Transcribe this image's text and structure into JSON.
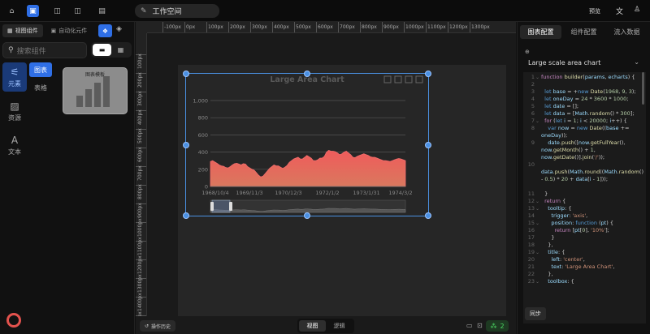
{
  "topbar": {
    "workspace_title": "工作空间",
    "preview_label": "预览",
    "right_icons": [
      "translate-icon",
      "user-icon"
    ]
  },
  "left": {
    "tabs": [
      {
        "label": "视图组件",
        "active": true
      },
      {
        "label": "自动化元件",
        "active": false
      }
    ],
    "search_placeholder": "搜索组件",
    "rail": [
      {
        "label": "元素",
        "icon": "elements-icon",
        "active": true
      },
      {
        "label": "资源",
        "icon": "image-icon",
        "active": false
      },
      {
        "label": "文本",
        "icon": "text-icon",
        "active": false
      }
    ],
    "categories": [
      {
        "label": "图表",
        "active": true
      },
      {
        "label": "表格",
        "active": false
      }
    ],
    "template_card_label": "图表模板"
  },
  "rulers": {
    "h": [
      "-100px",
      "0px",
      "100px",
      "200px",
      "300px",
      "400px",
      "500px",
      "600px",
      "700px",
      "800px",
      "900px",
      "1000px",
      "1100px",
      "1200px",
      "1300px"
    ],
    "v": [
      "100px",
      "200px",
      "300px",
      "400px",
      "500px",
      "600px",
      "700px",
      "800px",
      "900px",
      "1000px",
      "1100px",
      "1200px",
      "1300px",
      "1400px",
      "1500px",
      "1600px"
    ]
  },
  "chart_data": {
    "type": "area",
    "title": "Large Area Chart",
    "x_tick_labels": [
      "1968/10/4",
      "1969/11/3",
      "1970/12/3",
      "1972/1/2",
      "1973/1/31",
      "1974/3/2"
    ],
    "y_ticks": [
      0,
      200,
      400,
      600,
      800,
      "1,000"
    ],
    "ylim": [
      0,
      1000
    ],
    "values": [
      290,
      300,
      285,
      270,
      250,
      240,
      235,
      220,
      215,
      230,
      250,
      265,
      270,
      260,
      250,
      265,
      260,
      230,
      215,
      200,
      190,
      160,
      130,
      110,
      120,
      150,
      180,
      210,
      230,
      250,
      240,
      240,
      225,
      210,
      225,
      245,
      280,
      300,
      320,
      330,
      340,
      320,
      320,
      340,
      360,
      345,
      330,
      300,
      300,
      310,
      330,
      330,
      350,
      400,
      420,
      410,
      410,
      405,
      390,
      370,
      380,
      400,
      410,
      390,
      370,
      340,
      335,
      350,
      360,
      370,
      380,
      370,
      360,
      345,
      340,
      340,
      330,
      320,
      310,
      300,
      300,
      295,
      290,
      300,
      310,
      320,
      325,
      320,
      310,
      300
    ],
    "area_color_top": "#f05b5b",
    "area_color_bottom": "#d9785e",
    "grid": true,
    "datazoom": true
  },
  "bottom": {
    "history_label": "操作历史",
    "modes": [
      {
        "label": "视图",
        "active": true
      },
      {
        "label": "逻辑",
        "active": false
      }
    ],
    "online_count": "2"
  },
  "right": {
    "tabs": [
      {
        "label": "图表配置",
        "active": true
      },
      {
        "label": "组件配置",
        "active": false
      },
      {
        "label": "流入数据",
        "active": false
      }
    ],
    "select_value": "Large scale area chart",
    "sync_label": "同步",
    "code": [
      {
        "n": "1",
        "fold": "⌄",
        "lines": 1,
        "html": "<span class='kw'>function</span> <span class='fn'>builder</span><span class='pl'>(</span><span class='id'>params</span><span class='pl'>, </span><span class='id'>echarts</span><span class='pl'>) {</span>"
      },
      {
        "n": "2",
        "fold": "",
        "lines": 1,
        "html": ""
      },
      {
        "n": "3",
        "fold": "",
        "lines": 1,
        "html": "&nbsp;&nbsp;<span class='kw2'>let</span> <span class='id'>base</span> <span class='pl'>= +</span><span class='kw2'>new</span> <span class='fn'>Date</span><span class='pl'>(</span><span class='num'>1968</span><span class='pl'>, </span><span class='num'>9</span><span class='pl'>, </span><span class='num'>3</span><span class='pl'>);</span>"
      },
      {
        "n": "4",
        "fold": "",
        "lines": 1,
        "html": "&nbsp;&nbsp;<span class='kw2'>let</span> <span class='id'>oneDay</span> <span class='pl'>= </span><span class='num'>24</span> <span class='pl'>*</span> <span class='num'>3600</span> <span class='pl'>*</span> <span class='num'>1000</span><span class='pl'>;</span>"
      },
      {
        "n": "5",
        "fold": "",
        "lines": 1,
        "html": "&nbsp;&nbsp;<span class='kw2'>let</span> <span class='id'>date</span> <span class='pl'>= [];</span>"
      },
      {
        "n": "6",
        "fold": "",
        "lines": 1,
        "html": "&nbsp;&nbsp;<span class='kw2'>let</span> <span class='id'>data</span> <span class='pl'>= [</span><span class='id'>Math</span><span class='pl'>.</span><span class='fn'>random</span><span class='pl'>() * </span><span class='num'>300</span><span class='pl'>];</span>"
      },
      {
        "n": "7",
        "fold": "⌄",
        "lines": 1,
        "html": "&nbsp;&nbsp;<span class='kw'>for</span> <span class='pl'>(</span><span class='kw2'>let</span> <span class='id'>i</span> <span class='pl'>= </span><span class='num'>1</span><span class='pl'>; </span><span class='id'>i</span> <span class='pl'>&lt; </span><span class='num'>20000</span><span class='pl'>; </span><span class='id'>i</span><span class='pl'>++) {</span>"
      },
      {
        "n": "8",
        "fold": "",
        "lines": 2,
        "html": "&nbsp;&nbsp;&nbsp;&nbsp;<span class='kw2'>var</span> <span class='id'>now</span> <span class='pl'>= </span><span class='kw2'>new</span> <span class='fn'>Date</span><span class='pl'>((</span><span class='id'>base</span> <span class='pl'>+= </span><span class='id'>oneDay</span><span class='pl'>));</span>"
      },
      {
        "n": "9",
        "fold": "",
        "lines": 3,
        "html": "&nbsp;&nbsp;&nbsp;&nbsp;<span class='id'>date</span><span class='pl'>.</span><span class='fn'>push</span><span class='pl'>([</span><span class='id'>now</span><span class='pl'>.</span><span class='fn'>getFullYear</span><span class='pl'>(), </span><span class='id'>now</span><span class='pl'>.</span><span class='fn'>getMonth</span><span class='pl'>() + </span><span class='num'>1</span><span class='pl'>, </span><span class='id'>now</span><span class='pl'>.</span><span class='fn'>getDate</span><span class='pl'>()].</span><span class='fn'>join</span><span class='pl'>(</span><span class='str'>'/'</span><span class='pl'>));</span>"
      },
      {
        "n": "10",
        "fold": "",
        "lines": 4,
        "html": "<br><span class='id'>data</span><span class='pl'>.</span><span class='fn'>push</span><span class='pl'>(</span><span class='id'>Math</span><span class='pl'>.</span><span class='fn'>round</span><span class='pl'>((</span><span class='id'>Math</span><span class='pl'>.</span><span class='fn'>random</span><span class='pl'>() - </span><span class='num'>0.5</span><span class='pl'>) * </span><span class='num'>20</span> <span class='pl'>+ </span><span class='id'>data</span><span class='pl'>[</span><span class='id'>i</span> <span class='pl'>- </span><span class='num'>1</span><span class='pl'>]));</span>"
      },
      {
        "n": "11",
        "fold": "",
        "lines": 1,
        "html": "&nbsp;&nbsp;<span class='pl'>}</span>"
      },
      {
        "n": "12",
        "fold": "⌄",
        "lines": 1,
        "html": "&nbsp;&nbsp;<span class='kw'>return</span> <span class='pl'>{</span>"
      },
      {
        "n": "13",
        "fold": "⌄",
        "lines": 1,
        "html": "&nbsp;&nbsp;&nbsp;&nbsp;<span class='id'>tooltip</span><span class='pl'>: {</span>"
      },
      {
        "n": "14",
        "fold": "",
        "lines": 1,
        "html": "&nbsp;&nbsp;&nbsp;&nbsp;&nbsp;&nbsp;<span class='id'>trigger</span><span class='pl'>: </span><span class='str'>'axis'</span><span class='pl'>,</span>"
      },
      {
        "n": "15",
        "fold": "⌄",
        "lines": 1,
        "html": "&nbsp;&nbsp;&nbsp;&nbsp;&nbsp;&nbsp;<span class='id'>position</span><span class='pl'>: </span><span class='kw2'>function</span> <span class='pl'>(</span><span class='id'>pt</span><span class='pl'>) {</span>"
      },
      {
        "n": "16",
        "fold": "",
        "lines": 1,
        "html": "&nbsp;&nbsp;&nbsp;&nbsp;&nbsp;&nbsp;&nbsp;&nbsp;<span class='kw'>return</span> <span class='pl'>[</span><span class='id'>pt</span><span class='pl'>[</span><span class='num'>0</span><span class='pl'>], </span><span class='str'>'10%'</span><span class='pl'>];</span>"
      },
      {
        "n": "17",
        "fold": "",
        "lines": 1,
        "html": "&nbsp;&nbsp;&nbsp;&nbsp;&nbsp;&nbsp;<span class='pl'>}</span>"
      },
      {
        "n": "18",
        "fold": "",
        "lines": 1,
        "html": "&nbsp;&nbsp;&nbsp;&nbsp;<span class='pl'>},</span>"
      },
      {
        "n": "19",
        "fold": "⌄",
        "lines": 1,
        "html": "&nbsp;&nbsp;&nbsp;&nbsp;<span class='id'>title</span><span class='pl'>: {</span>"
      },
      {
        "n": "20",
        "fold": "",
        "lines": 1,
        "html": "&nbsp;&nbsp;&nbsp;&nbsp;&nbsp;&nbsp;<span class='id'>left</span><span class='pl'>: </span><span class='str'>'center'</span><span class='pl'>,</span>"
      },
      {
        "n": "21",
        "fold": "",
        "lines": 1,
        "html": "&nbsp;&nbsp;&nbsp;&nbsp;&nbsp;&nbsp;<span class='id'>text</span><span class='pl'>: </span><span class='str'>'Large Area Chart'</span><span class='pl'>,</span>"
      },
      {
        "n": "22",
        "fold": "",
        "lines": 1,
        "html": "&nbsp;&nbsp;&nbsp;&nbsp;<span class='pl'>},</span>"
      },
      {
        "n": "23",
        "fold": "⌄",
        "lines": 1,
        "html": "&nbsp;&nbsp;&nbsp;&nbsp;<span class='id'>toolbox</span><span class='pl'>: {</span>"
      }
    ]
  }
}
